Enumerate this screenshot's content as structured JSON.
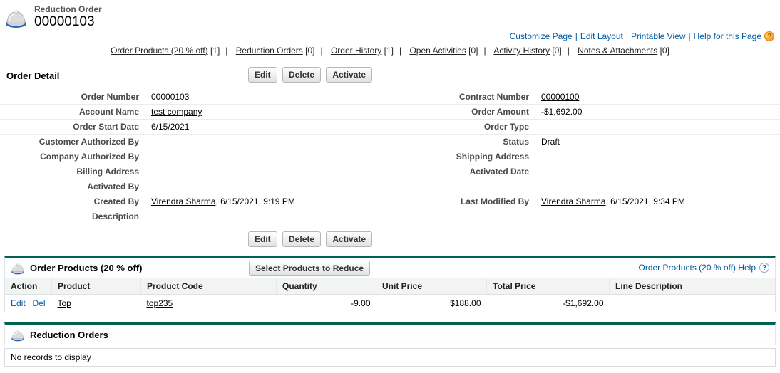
{
  "page": {
    "entity_type": "Reduction Order",
    "record_number": "00000103"
  },
  "top_links": {
    "separator": "|",
    "customize_page": "Customize Page",
    "edit_layout": "Edit Layout",
    "printable_view": "Printable View",
    "help_for_page": "Help for this Page",
    "help_icon": "?"
  },
  "related_links": {
    "separator": "|",
    "items": [
      {
        "label": "Order Products (20 % off)",
        "count": "[1]"
      },
      {
        "label": "Reduction Orders",
        "count": "[0]"
      },
      {
        "label": "Order History",
        "count": "[1]"
      },
      {
        "label": "Open Activities",
        "count": "[0]"
      },
      {
        "label": "Activity History",
        "count": "[0]"
      },
      {
        "label": "Notes & Attachments",
        "count": "[0]"
      }
    ]
  },
  "order_detail": {
    "title": "Order Detail",
    "buttons": {
      "edit": "Edit",
      "delete": "Delete",
      "activate": "Activate"
    },
    "left": [
      {
        "label": "Order Number",
        "value": "00000103"
      },
      {
        "label": "Account Name",
        "value": "test company"
      },
      {
        "label": "Order Start Date",
        "value": "6/15/2021"
      },
      {
        "label": "Customer Authorized By",
        "value": ""
      },
      {
        "label": "Company Authorized By",
        "value": ""
      },
      {
        "label": "Billing Address",
        "value": ""
      },
      {
        "label": "Activated By",
        "value": ""
      },
      {
        "label": "Created By",
        "link": "Virendra Sharma",
        "rest": ", 6/15/2021, 9:19 PM"
      },
      {
        "label": "Description",
        "value": ""
      }
    ],
    "right": [
      {
        "label": "Contract Number",
        "value": "00000100"
      },
      {
        "label": "Order Amount",
        "value": "-$1,692.00"
      },
      {
        "label": "Order Type",
        "value": ""
      },
      {
        "label": "Status",
        "value": "Draft"
      },
      {
        "label": "Shipping Address",
        "value": ""
      },
      {
        "label": "Activated Date",
        "value": ""
      },
      {
        "label": "",
        "value": ""
      },
      {
        "label": "Last Modified By",
        "link": "Virendra Sharma",
        "rest": ", 6/15/2021, 9:34 PM"
      },
      {
        "label": "",
        "value": ""
      }
    ]
  },
  "order_products": {
    "title": "Order Products (20 % off)",
    "action_button": "Select Products to Reduce",
    "help_link": "Order Products (20 % off) Help",
    "help_icon": "?",
    "columns": [
      "Action",
      "Product",
      "Product Code",
      "Quantity",
      "Unit Price",
      "Total Price",
      "Line Description"
    ],
    "row": {
      "edit": "Edit",
      "del": "Del",
      "sep": "|",
      "product": "Top",
      "product_code": "top235",
      "quantity": "-9.00",
      "unit_price": "$188.00",
      "total_price": "-$1,692.00",
      "line_description": ""
    }
  },
  "reduction_orders": {
    "title": "Reduction Orders",
    "empty_message": "No records to display"
  },
  "colors": {
    "accent_teal": "#006252",
    "link_blue": "#015ba7",
    "help_orange": "#f7a128"
  }
}
